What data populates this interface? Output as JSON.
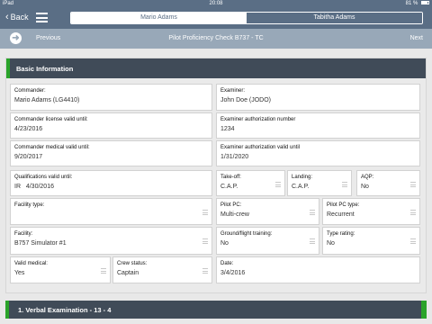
{
  "status": {
    "device": "iPad",
    "wifi_icon": "wifi-icon",
    "time": "20:08",
    "battery": "81 %"
  },
  "nav": {
    "back_label": "Back",
    "segments": [
      {
        "label": "Mario Adams"
      },
      {
        "label": "Tabitha Adams"
      }
    ]
  },
  "subnav": {
    "previous": "Previous",
    "title": "Pilot Proficiency Check B737 - TC",
    "next": "Next"
  },
  "card": {
    "title": "Basic Information",
    "fields": {
      "commander": {
        "label": "Commander:",
        "value": "Mario Adams (LG4410)"
      },
      "examiner": {
        "label": "Examiner:",
        "value": "John Doe (JODO)"
      },
      "commander_license": {
        "label": "Commander license valid until:",
        "value": "4/23/2016"
      },
      "examiner_auth_number": {
        "label": "Examiner authorization number",
        "value": "1234"
      },
      "commander_medical": {
        "label": "Commander medical valid until:",
        "value": "9/20/2017"
      },
      "examiner_auth_valid": {
        "label": "Examiner authorization valid until",
        "value": "1/31/2020"
      },
      "qualifications": {
        "label": "Qualifications valid until:",
        "value": "IR   4/30/2016"
      },
      "takeoff": {
        "label": "Take-off:",
        "value": "C.A.P."
      },
      "landing": {
        "label": "Landing:",
        "value": "C.A.P."
      },
      "aqp": {
        "label": "AQP:",
        "value": "No"
      },
      "facility_type": {
        "label": "Facility type:",
        "value": ""
      },
      "pilot_pc": {
        "label": "Pilot PC:",
        "value": "Multi-crew"
      },
      "pilot_pc_type": {
        "label": "Pilot PC type:",
        "value": "Recurrent"
      },
      "facility": {
        "label": "Facility:",
        "value": "B757 Simulator #1"
      },
      "ground_flight_training": {
        "label": "Ground/flight training:",
        "value": "No"
      },
      "type_rating": {
        "label": "Type rating:",
        "value": "No"
      },
      "valid_medical": {
        "label": "Valid medical:",
        "value": "Yes"
      },
      "crew_status": {
        "label": "Crew status:",
        "value": "Captain"
      },
      "date": {
        "label": "Date:",
        "value": "3/4/2016"
      }
    }
  },
  "section2": {
    "title": "1. Verbal Examination - 13 - 4"
  },
  "colors": {
    "nav": "#5a6e85",
    "subnav": "#98a8b8",
    "header": "#404b58",
    "accent": "#2aa32a"
  }
}
